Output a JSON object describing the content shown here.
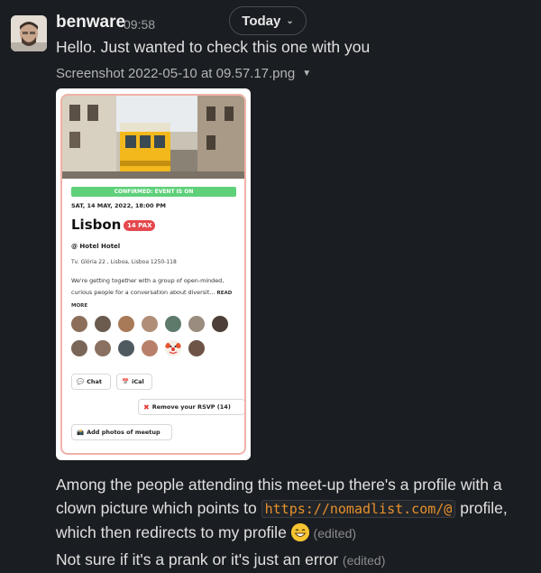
{
  "date_divider": {
    "label": "Today"
  },
  "message": {
    "sender": "benware",
    "time": "09:58",
    "text": "Hello. Just wanted to check this one with you",
    "attachment": {
      "filename": "Screenshot 2022-05-10 at 09.57.17.png",
      "card": {
        "status": "CONFIRMED: EVENT IS ON",
        "date": "SAT, 14 MAY, 2022, 18:00 PM",
        "city": "Lisbon",
        "pax": "14 PAX",
        "venue": "@ Hotel Hotel",
        "address": "Tv. Glória 22 , Lisboa, Lisboa 1250-118",
        "description": "We're getting together with a group of open-minded, curious people for a conversation about diversit...",
        "read_more": "READ MORE",
        "chat_label": "Chat",
        "ical_label": "iCal",
        "remove_rsvp_label": "Remove your RSVP (14)",
        "add_photos_label": "Add photos of meetup"
      }
    }
  },
  "follow_ups": {
    "p1_before": "Among the people attending this meet-up there's a profile with a clown picture which points to ",
    "p1_code": "https://nomadlist.com/@",
    "p1_after": " profile, which then redirects to my profile ",
    "p1_edited": "(edited)",
    "p2": "Not sure if it's a prank or it's just an error ",
    "p2_edited": "(edited)"
  },
  "icons": {
    "today_dropdown": "chevron-down-icon",
    "file_dropdown": "caret-down-icon",
    "chat": "speech-bubble-icon",
    "ical": "calendar-icon",
    "remove": "red-x-icon",
    "camera": "camera-icon",
    "emoji": "grinning-face-emoji"
  },
  "colors": {
    "background": "#1a1d21",
    "confirmed": "#5ed07a",
    "pax_badge": "#e5484d",
    "code_text": "#e8912d",
    "card_border": "#f0b2a6"
  }
}
